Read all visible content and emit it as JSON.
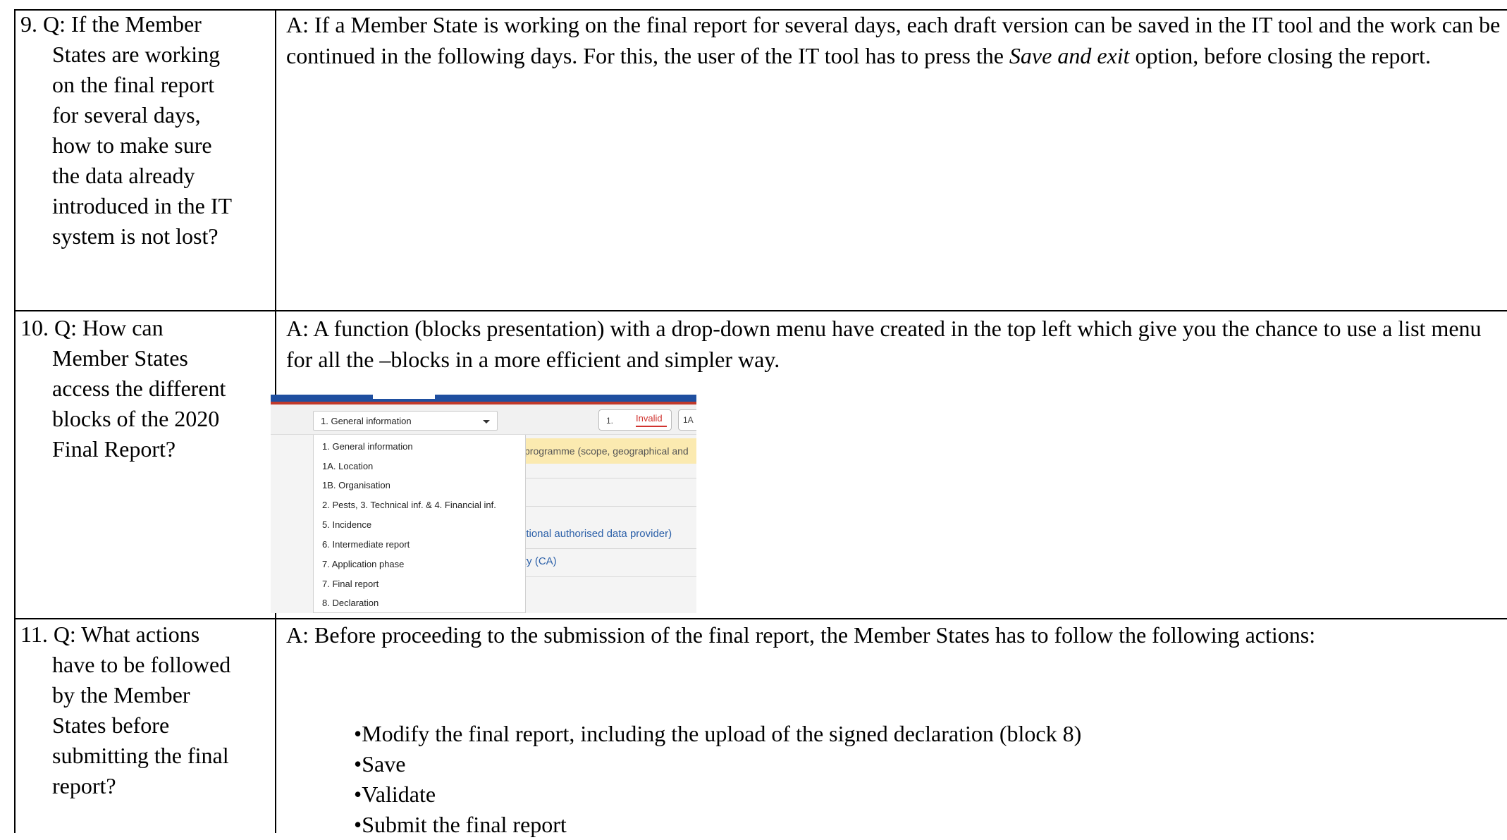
{
  "rows": [
    {
      "question_lines": [
        "9.  Q: If the Member",
        "States are working",
        "on the final report",
        "for several days,",
        "how to make sure",
        "the data already",
        "introduced in the IT",
        "system is not lost?"
      ],
      "answer_parts": {
        "before": "A: If a Member State is working on the final report for several days, each draft version can be saved in the IT tool and the work can be continued in the following days. For this, the user of the IT tool has to press the ",
        "emphasis": "Save and exit",
        "after": " option, before closing the report."
      }
    },
    {
      "question_lines": [
        "10. Q: How can",
        "Member States",
        "access the different",
        "blocks of the 2020",
        "Final Report?"
      ],
      "answer": "A: A function (blocks presentation) with a drop-down menu have created in the top left which give you the chance to use a list menu for all the –blocks in a more efficient and simpler way.",
      "screenshot": {
        "selected_block": "1. General information",
        "status_number": "1.",
        "status_label": "Invalid",
        "status2_label": "1A",
        "banner_text": "programme (scope, geographical and",
        "link_text_1": "itional authorised data provider)",
        "link_text_2": "ty (CA)",
        "menu_items": [
          "1. General information",
          "1A. Location",
          "1B. Organisation",
          "2. Pests, 3. Technical inf. & 4. Financial inf.",
          "5. Incidence",
          "6. Intermediate report",
          "7. Application phase",
          "7. Final report",
          "8. Declaration"
        ],
        "colors": {
          "header_blue": "#1f4fa0",
          "header_red": "#c0392b",
          "invalid_red": "#d0332f",
          "link_blue": "#2a5fa8",
          "banner_yellow": "#fbeab0"
        }
      }
    },
    {
      "question_lines": [
        "11. Q: What actions",
        "have to be followed",
        "by the Member",
        "States before",
        "submitting the final",
        "report?"
      ],
      "answer": "A: Before proceeding to the submission of the final report, the Member States has to follow the following actions:",
      "bullets": [
        "•Modify the final report, including the upload of the signed declaration (block 8)",
        "•Save",
        "•Validate",
        "•Submit the final report"
      ]
    }
  ]
}
